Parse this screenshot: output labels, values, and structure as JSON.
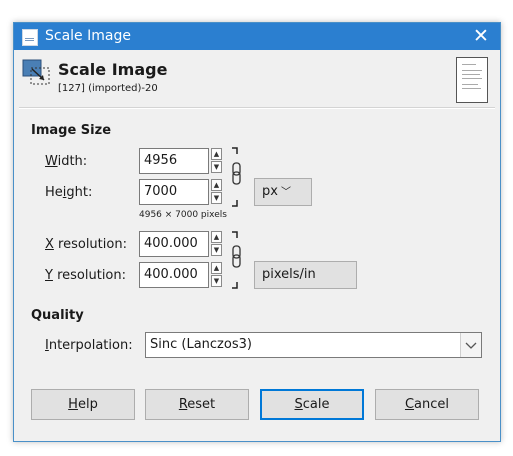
{
  "window": {
    "title": "Scale Image"
  },
  "header": {
    "title": "Scale Image",
    "subtitle": "[127] (imported)-20"
  },
  "image_size": {
    "section_label": "Image Size",
    "width": {
      "mnemonic": "W",
      "rest": "idth:",
      "value": "4956"
    },
    "height": {
      "pre": "He",
      "mnemonic": "i",
      "rest": "ght:",
      "value": "7000"
    },
    "pixel_hint": "4956 × 7000 pixels",
    "size_unit": "px",
    "x_resolution": {
      "mnemonic": "X",
      "rest": " resolution:",
      "value": "400.000"
    },
    "y_resolution": {
      "mnemonic": "Y",
      "rest": " resolution:",
      "value": "400.000"
    },
    "resolution_unit": "pixels/in"
  },
  "quality": {
    "section_label": "Quality",
    "interpolation": {
      "mnemonic": "I",
      "rest": "nterpolation:",
      "value": "Sinc (Lanczos3)"
    }
  },
  "buttons": {
    "help": {
      "mnemonic": "H",
      "rest": "elp"
    },
    "reset": {
      "mnemonic": "R",
      "rest": "eset"
    },
    "scale": {
      "mnemonic": "S",
      "rest": "cale"
    },
    "cancel": {
      "mnemonic": "C",
      "rest": "ancel"
    }
  },
  "colors": {
    "titlebar": "#2b7fd0",
    "default_button_border": "#0078d7",
    "dialog_bg": "#f0f0f0"
  },
  "icons": [
    "app-icon",
    "close-icon",
    "scale-image-icon",
    "image-thumbnail-icon",
    "spin-up-icon",
    "spin-down-icon",
    "chain-link-icon",
    "chevron-down-icon"
  ]
}
